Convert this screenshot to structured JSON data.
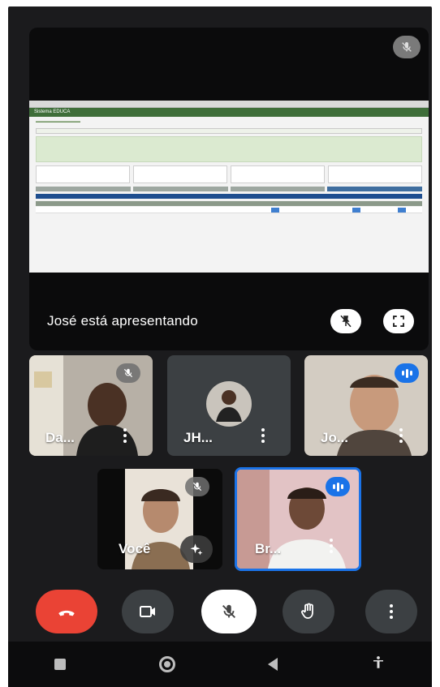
{
  "presentation": {
    "status_text": "José está apresentando",
    "shared_app_title": "Sistema EDUCA"
  },
  "participants": [
    {
      "name": "Da...",
      "muted": true,
      "speaking": false
    },
    {
      "name": "JH...",
      "muted": false,
      "speaking": false
    },
    {
      "name": "Jo...",
      "muted": false,
      "speaking": true
    },
    {
      "name": "Você",
      "muted": true,
      "speaking": false
    },
    {
      "name": "Br...",
      "muted": false,
      "speaking": true
    }
  ],
  "colors": {
    "end_call": "#ea4335",
    "speaking_blue": "#1a73e8",
    "control_bg": "#3c4043",
    "screen_bg": "#1b1b1d"
  },
  "icons": {
    "end_call": "phone-hangup-icon",
    "camera": "video-camera-icon",
    "mic": "mic-off-icon",
    "hand": "raise-hand-icon",
    "more": "more-vertical-icon",
    "unpin": "unpin-icon",
    "fullscreen": "fullscreen-icon",
    "effects": "sparkle-effects-icon"
  }
}
